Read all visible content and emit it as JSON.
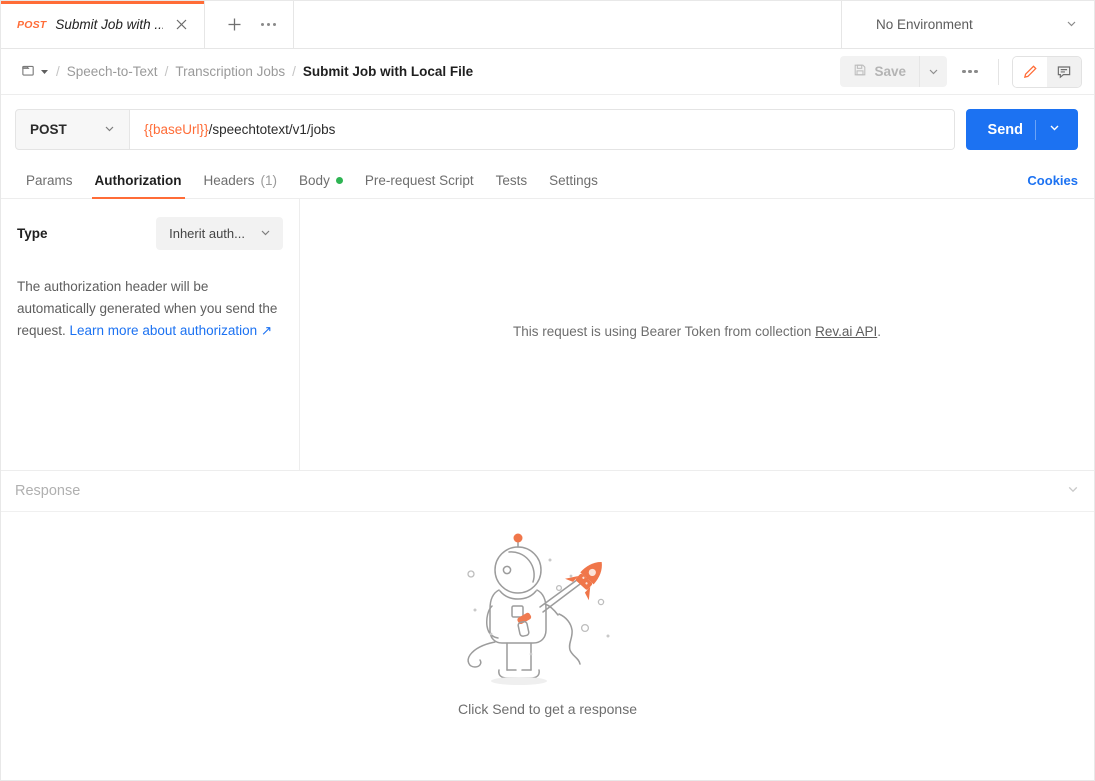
{
  "tabbar": {
    "tab": {
      "method": "POST",
      "title": "Submit Job with ...",
      "close_icon": "close-icon"
    },
    "new_tab_icon": "plus-icon",
    "more_icon": "ellipsis-icon",
    "environment": {
      "label": "No Environment",
      "caret_icon": "chevron-down-icon"
    }
  },
  "breadcrumb": {
    "folder_icon": "folder-icon",
    "folder_caret_icon": "caret-down-icon",
    "separator": "/",
    "items": [
      {
        "label": "Speech-to-Text",
        "current": false
      },
      {
        "label": "Transcription Jobs",
        "current": false
      },
      {
        "label": "Submit Job with Local File",
        "current": true
      }
    ],
    "actions": {
      "save_label": "Save",
      "save_icon": "floppy-disk-icon",
      "save_caret_icon": "chevron-down-icon",
      "more_icon": "ellipsis-icon",
      "edit_icon": "pencil-icon",
      "comment_icon": "comment-icon"
    }
  },
  "request": {
    "method": "POST",
    "method_caret_icon": "chevron-down-icon",
    "url_variable": "{{baseUrl}}",
    "url_path": "/speechtotext/v1/jobs",
    "send_label": "Send",
    "send_caret_icon": "chevron-down-icon"
  },
  "request_tabs": {
    "items": [
      {
        "label": "Params",
        "active": false,
        "count": "",
        "dot": false
      },
      {
        "label": "Authorization",
        "active": true,
        "count": "",
        "dot": false
      },
      {
        "label": "Headers",
        "active": false,
        "count": "(1)",
        "dot": false
      },
      {
        "label": "Body",
        "active": false,
        "count": "",
        "dot": true
      },
      {
        "label": "Pre-request Script",
        "active": false,
        "count": "",
        "dot": false
      },
      {
        "label": "Tests",
        "active": false,
        "count": "",
        "dot": false
      },
      {
        "label": "Settings",
        "active": false,
        "count": "",
        "dot": false
      }
    ],
    "cookies_label": "Cookies"
  },
  "authorization": {
    "type_label": "Type",
    "type_value": "Inherit auth...",
    "type_caret_icon": "chevron-down-icon",
    "description_text": "The authorization header will be automatically generated when you send the request. ",
    "description_link": "Learn more about authorization",
    "description_link_icon": "external-link-icon",
    "inherited_prefix": "This request is using Bearer Token from collection ",
    "inherited_collection": "Rev.ai API",
    "inherited_suffix": "."
  },
  "response": {
    "title": "Response",
    "collapse_icon": "chevron-down-icon",
    "empty_illustration": "astronaut-with-rocket-illustration",
    "empty_caption": "Click Send to get a response"
  },
  "colors": {
    "accent_orange": "#ff6c37",
    "send_blue": "#1c72f2",
    "link_blue": "#1c72f2",
    "body_dot_green": "#2eb453",
    "illustration_line": "#9c9c9c"
  }
}
